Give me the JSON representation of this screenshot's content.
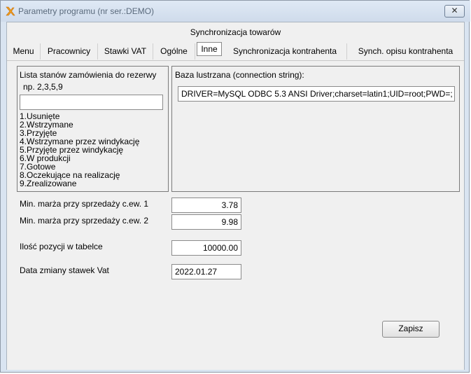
{
  "window": {
    "title": "Parametry programu (nr ser.:DEMO)",
    "close_glyph": "✕"
  },
  "tabs_top": [
    "Synchronizacja towarów"
  ],
  "tabs": [
    {
      "label": "Menu"
    },
    {
      "label": "Pracownicy"
    },
    {
      "label": "Stawki VAT"
    },
    {
      "label": "Ogólne"
    },
    {
      "label": "Inne",
      "active": true
    },
    {
      "label": "Synchronizacja kontrahenta"
    },
    {
      "label": "Synch. opisu kontrahenta"
    }
  ],
  "reservation": {
    "title": "Lista stanów zamówienia do rezerwy",
    "example": "np. 2,3,5,9",
    "value": "",
    "statuses": [
      "1.Usunięte",
      "2.Wstrzymane",
      "3.Przyjęte",
      "4.Wstrzymane przez windykację",
      "5.Przyjęte przez windykację",
      "6.W produkcji",
      "7.Gotowe",
      "8.Oczekujące na realizację",
      "9.Zrealizowane"
    ]
  },
  "mirror": {
    "title": "Baza lustrzana (connection string):",
    "value": "DRIVER=MySQL ODBC 5.3 ANSI Driver;charset=latin1;UID=root;PWD=;"
  },
  "fields": {
    "margin1_label": "Min. marża przy sprzedaży c.ew. 1",
    "margin1_value": "3.78",
    "margin2_label": "Min. marża przy sprzedaży c.ew. 2",
    "margin2_value": "9.98",
    "rows_label": "Ilość pozycji w tabelce",
    "rows_value": "10000.00",
    "vat_date_label": "Data zmiany stawek Vat",
    "vat_date_value": "2022.01.27"
  },
  "save_button": "Zapisz"
}
